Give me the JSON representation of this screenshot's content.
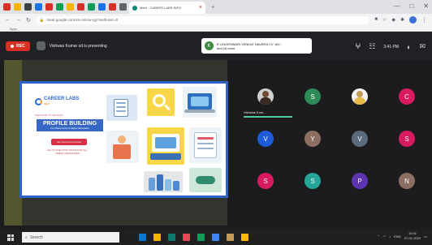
{
  "browser": {
    "active_tab": {
      "title": "Meet - CAREER LABS INFO",
      "close": "×"
    },
    "new_tab": "+",
    "window_controls": [
      "—",
      "□",
      "✕"
    ],
    "url": "meet.google.com/xtv-mknw-rgz?authuser=0",
    "bookmarks_label": "Apps",
    "pinned_tab_colors": [
      "#d93025",
      "#f4b400",
      "#3c4043",
      "#1a73e8",
      "#d93025",
      "#0f9d58",
      "#f4b400",
      "#d93025",
      "#0f9d58",
      "#1a73e8",
      "#d93025",
      "#5f6368"
    ]
  },
  "meet": {
    "rec_label": "REC",
    "presenter_text": "Vishwas Kumar sd is presenting",
    "meeting_initial": "K",
    "meeting_line1": "R LINGESWARI VENKAT NAVEEN CV JAY...",
    "meeting_line2": "and 16 more",
    "time": "3:41 PM",
    "top_icons": [
      "people-icon",
      "chat-icon",
      "activities-icon",
      "more-icon"
    ]
  },
  "slide": {
    "brand": "CAREER LABS",
    "brand_sub": "INFO",
    "welcome": "WELCOME TO SESSION",
    "title": "PROFILE BUILDING",
    "subtitle": "For Placements & Higher Education",
    "button": "Get more from Course",
    "note": "ALL IN ONE STOP TOOLS FOR ALL FRESH GRADUATES"
  },
  "participants": [
    {
      "kind": "photo",
      "label": "Vishwas Kum..."
    },
    {
      "kind": "initial",
      "initial": "S",
      "color": "#2e8b57"
    },
    {
      "kind": "photo2",
      "label": ""
    },
    {
      "kind": "initial",
      "initial": "C",
      "color": "#d81b60"
    },
    {
      "kind": "initial",
      "initial": "V",
      "color": "#1e5bd8"
    },
    {
      "kind": "initial",
      "initial": "Y",
      "color": "#8d6e63"
    },
    {
      "kind": "initial",
      "initial": "V",
      "color": "#5c6b7a"
    },
    {
      "kind": "initial",
      "initial": "S",
      "color": "#d81b60"
    },
    {
      "kind": "initial",
      "initial": "S",
      "color": "#d81b60"
    },
    {
      "kind": "initial",
      "initial": "S",
      "color": "#26a69a"
    },
    {
      "kind": "initial",
      "initial": "P",
      "color": "#5e35b1"
    },
    {
      "kind": "initial",
      "initial": "N",
      "color": "#8d6e63"
    }
  ],
  "speaker_label": "Vishwas Kum...",
  "taskbar": {
    "search_placeholder": "Search",
    "time": "15:41",
    "date": "07-01-2022",
    "lang": "ENG",
    "app_colors": [
      "#0078d4",
      "#f5b400",
      "#0a7a6b",
      "#e74856",
      "#0f9d58",
      "#4285f4",
      "#c79b5a",
      "#ffb900"
    ]
  }
}
